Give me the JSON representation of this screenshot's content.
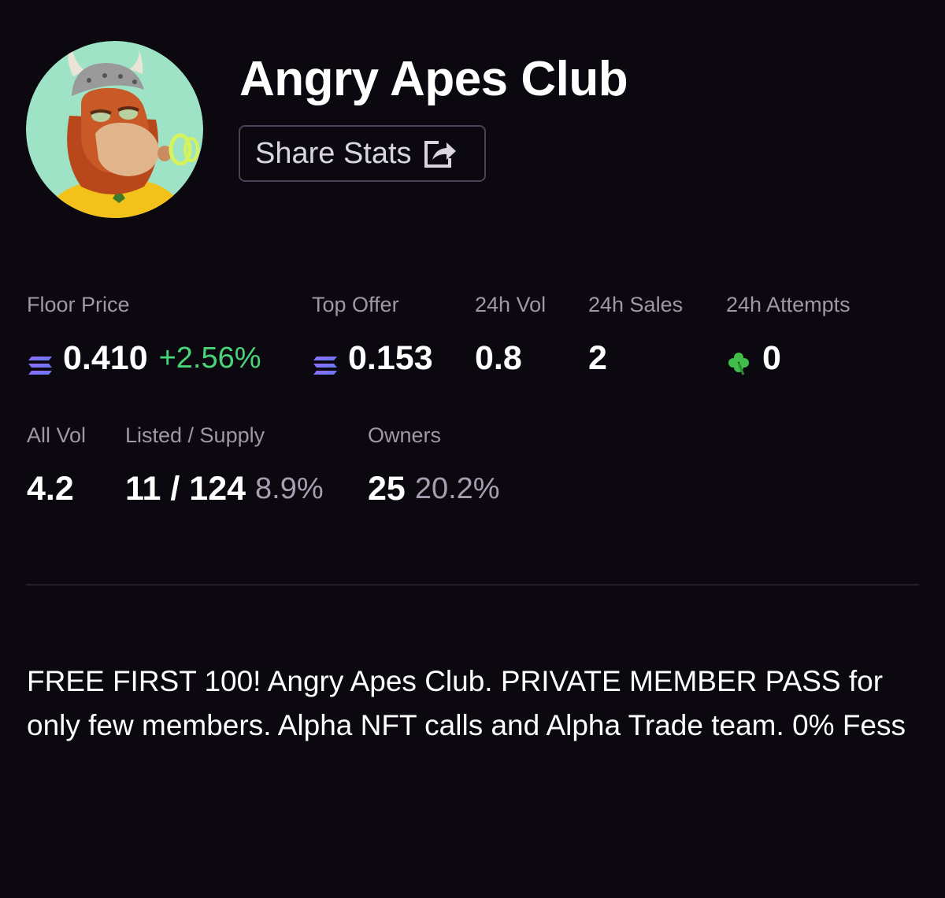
{
  "collection": {
    "name": "Angry Apes Club",
    "avatar_icon": "angry-ape-avatar"
  },
  "share": {
    "label": "Share Stats",
    "icon": "share-icon"
  },
  "stats": {
    "floor_price": {
      "label": "Floor Price",
      "value": "0.410",
      "change": "+2.56%",
      "currency_icon": "solana-icon"
    },
    "top_offer": {
      "label": "Top Offer",
      "value": "0.153",
      "currency_icon": "solana-icon"
    },
    "vol_24h": {
      "label": "24h Vol",
      "value": "0.8"
    },
    "sales_24h": {
      "label": "24h Sales",
      "value": "2"
    },
    "attempts_24h": {
      "label": "24h Attempts",
      "value": "0",
      "icon": "clover-icon"
    },
    "all_vol": {
      "label": "All Vol",
      "value": "4.2"
    },
    "listed_supply": {
      "label": "Listed / Supply",
      "value": "11 / 124",
      "pct": "8.9%"
    },
    "owners": {
      "label": "Owners",
      "value": "25",
      "pct": "20.2%"
    }
  },
  "description": "FREE FIRST 100! Angry Apes Club. PRIVATE MEMBER PASS for only few members. Alpha NFT calls and Alpha Trade team. 0% Fess",
  "colors": {
    "background": "#0b080f",
    "positive": "#4ad47a",
    "muted": "#9e98a8",
    "border": "#4a4258"
  }
}
